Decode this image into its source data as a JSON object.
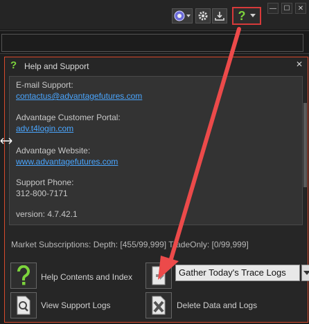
{
  "toolbar": {
    "minimize_glyph": "—",
    "maximize_glyph": "☐",
    "close_glyph": "✕",
    "help_glyph": "?",
    "accent_color": "#d83a3a",
    "help_color": "#7cd43c"
  },
  "help_window": {
    "title": "Help and Support",
    "title_icon_glyph": "?",
    "close_glyph": "✕",
    "email_label": "E-mail Support:",
    "email_link": "contactus@advantagefutures.com",
    "portal_label": "Advantage Customer Portal:",
    "portal_link": "adv.t4login.com",
    "website_label": "Advantage Website:",
    "website_link": "www.advantagefutures.com",
    "phone_label": "Support Phone:",
    "phone_value": "312-800-7171",
    "version": "version: 4.7.42.1",
    "subscriptions": "Market Subscriptions: Depth: [455/99,999] TradeOnly: [0/99,999]",
    "help_contents_label": "Help Contents and Index",
    "view_logs_label": "View Support Logs",
    "trace_select_value": "Gather Today's Trace Logs",
    "delete_label": "Delete Data and Logs"
  }
}
